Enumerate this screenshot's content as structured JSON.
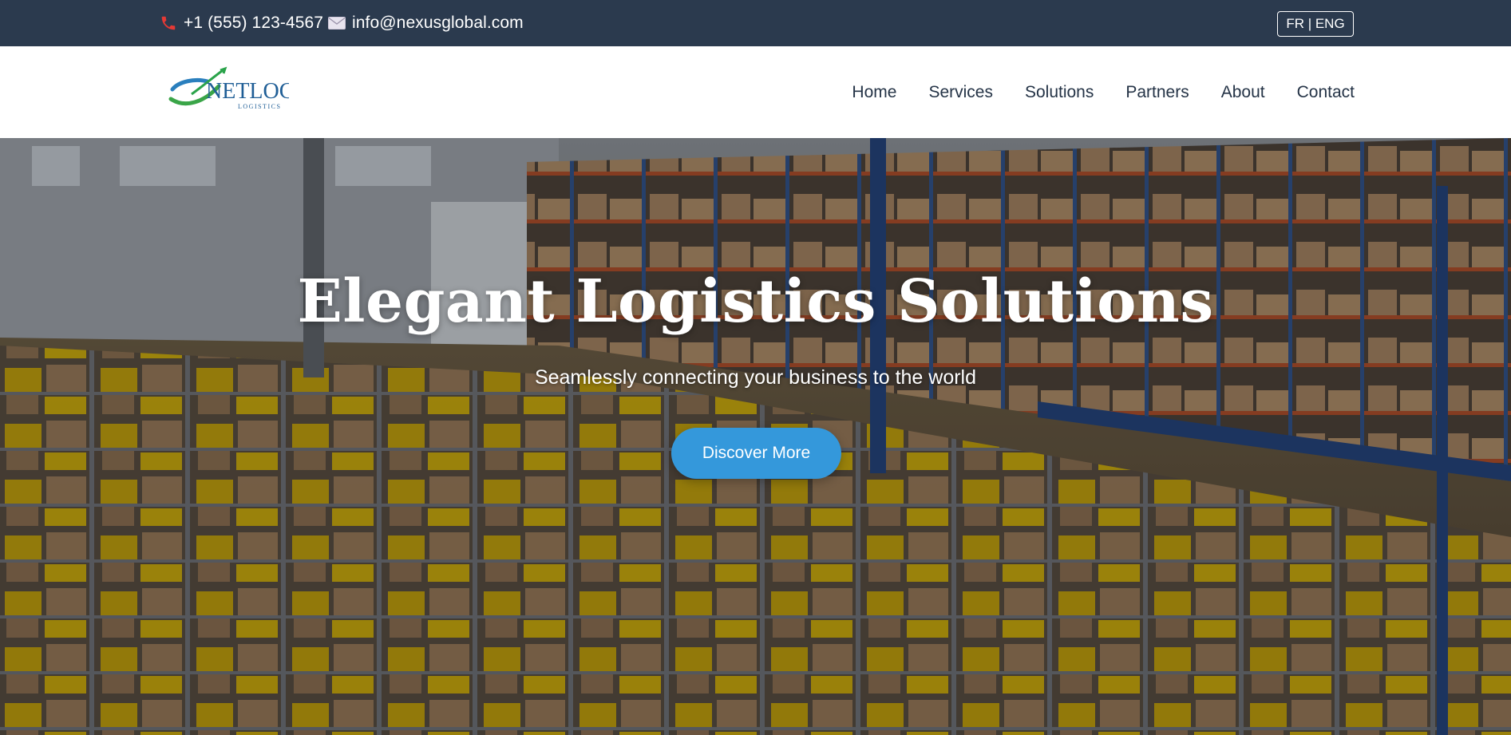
{
  "topbar": {
    "phone": "+1 (555) 123-4567",
    "email": "info@nexusglobal.com",
    "language_toggle": "FR | ENG",
    "phone_icon": "phone-icon",
    "email_icon": "mail-icon"
  },
  "logo": {
    "name": "NETLOG",
    "tagline": "LOGISTICS"
  },
  "nav": {
    "items": [
      {
        "label": "Home"
      },
      {
        "label": "Services"
      },
      {
        "label": "Solutions"
      },
      {
        "label": "Partners"
      },
      {
        "label": "About"
      },
      {
        "label": "Contact"
      }
    ]
  },
  "hero": {
    "title": "Elegant Logistics Solutions",
    "subtitle": "Seamlessly connecting your business to the world",
    "cta_label": "Discover More"
  },
  "colors": {
    "topbar_bg": "#2b3a4e",
    "nav_text": "#243346",
    "accent": "#3498db",
    "phone_icon": "#e53935"
  }
}
